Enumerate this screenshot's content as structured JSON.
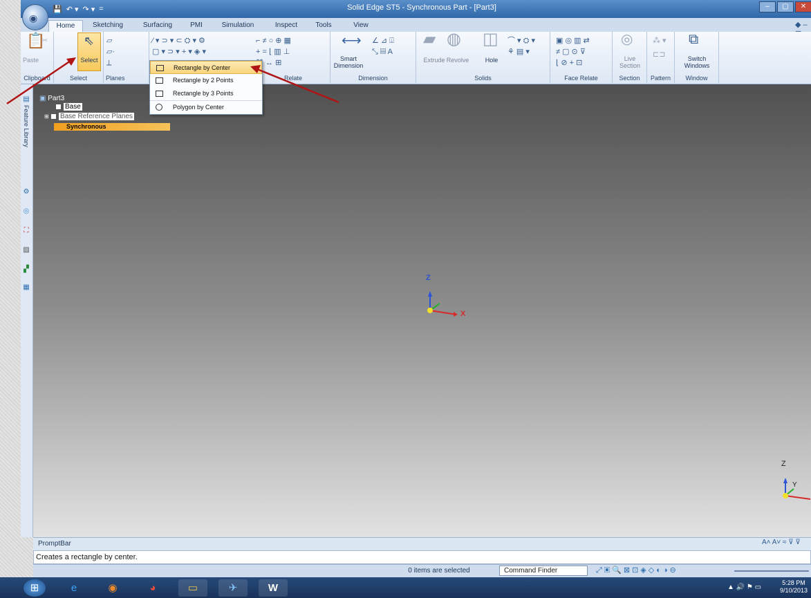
{
  "app": {
    "window_title": "Solid Edge ST5 - Synchronous Part - [Part3]",
    "qat": [
      "💾",
      "↶ ▾",
      "↷ ▾",
      "="
    ],
    "window_controls": [
      "–",
      "▢",
      "✕"
    ]
  },
  "tabs": [
    "Home",
    "Sketching",
    "Surfacing",
    "PMI",
    "Simulation",
    "Inspect",
    "Tools",
    "View"
  ],
  "ribbon": {
    "groups": [
      "Clipboard",
      "Select",
      "Planes",
      "Relate",
      "Dimension",
      "Solids",
      "Face Relate",
      "Section",
      "Pattern",
      "Window"
    ],
    "buttons": {
      "paste": "Paste",
      "select": "Select",
      "smart_dimension": "Smart Dimension",
      "extrude": "Extrude",
      "revolve": "Revolve",
      "hole": "Hole",
      "live_section": "Live Section",
      "switch_windows": "Switch Windows"
    },
    "help_icons": "◆ – ⊡"
  },
  "shape_menu": [
    {
      "label": "Rectangle by Center",
      "icon": "rect-center-icon",
      "highlighted": true
    },
    {
      "label": "Rectangle by 2 Points",
      "icon": "rect-2pt-icon",
      "highlighted": false
    },
    {
      "label": "Rectangle by 3 Points",
      "icon": "rect-3pt-icon",
      "highlighted": false
    },
    {
      "label": "Polygon by Center",
      "icon": "polygon-center-icon",
      "highlighted": false
    }
  ],
  "feature_library": {
    "label": "Feature Library"
  },
  "tree": {
    "root": "Part3",
    "items": [
      "Base",
      "Base Reference Planes",
      "Synchronous"
    ]
  },
  "axes": {
    "z": "Z",
    "x": "X",
    "y": "Y"
  },
  "promptbar": {
    "title": "PromptBar",
    "text": "Creates a rectangle by center.",
    "tools": "A˄ A˅ ≈ ⊽ ⊽"
  },
  "status": {
    "selection": "0 items are selected",
    "command_finder": "Command Finder"
  },
  "taskbar": {
    "time": "5:28 PM",
    "date": "9/10/2013"
  },
  "colors": {
    "arrow": "#b01414",
    "highlight": "#f9d57d",
    "sync_bar": "#f0a020"
  }
}
